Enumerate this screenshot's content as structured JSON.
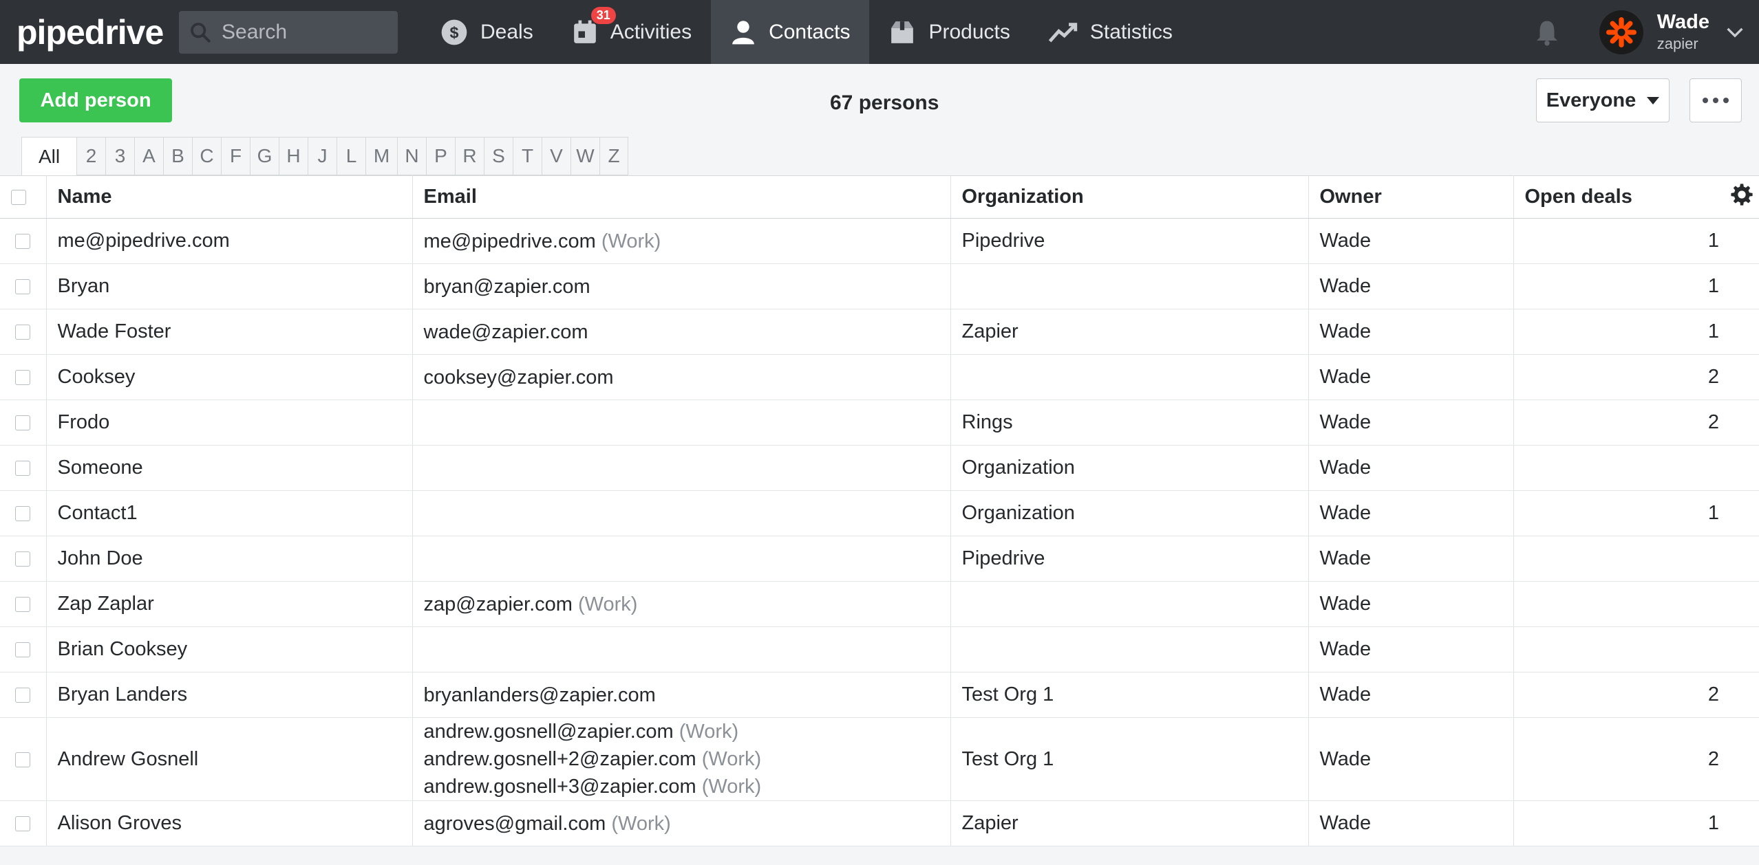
{
  "app": {
    "logo": "pipedrive"
  },
  "search": {
    "placeholder": "Search"
  },
  "nav": [
    {
      "label": "Deals",
      "icon": "dollar-icon"
    },
    {
      "label": "Activities",
      "icon": "calendar-icon",
      "badge": "31"
    },
    {
      "label": "Contacts",
      "icon": "person-icon",
      "active": true
    },
    {
      "label": "Products",
      "icon": "box-icon"
    },
    {
      "label": "Statistics",
      "icon": "trend-icon"
    }
  ],
  "user": {
    "name": "Wade",
    "company": "zapier"
  },
  "toolbar": {
    "add_label": "Add person",
    "count": "67 persons",
    "filter_label": "Everyone"
  },
  "alphabet": [
    "All",
    "2",
    "3",
    "A",
    "B",
    "C",
    "F",
    "G",
    "H",
    "J",
    "L",
    "M",
    "N",
    "P",
    "R",
    "S",
    "T",
    "V",
    "W",
    "Z"
  ],
  "columns": {
    "name": "Name",
    "email": "Email",
    "organization": "Organization",
    "owner": "Owner",
    "open_deals": "Open deals"
  },
  "work_tag": "(Work)",
  "rows": [
    {
      "name": "me@pipedrive.com",
      "emails": [
        {
          "addr": "me@pipedrive.com",
          "tag": "(Work)"
        }
      ],
      "org": "Pipedrive",
      "owner": "Wade",
      "deals": "1"
    },
    {
      "name": "Bryan",
      "emails": [
        {
          "addr": "bryan@zapier.com",
          "tag": ""
        }
      ],
      "org": "",
      "owner": "Wade",
      "deals": "1"
    },
    {
      "name": "Wade Foster",
      "emails": [
        {
          "addr": "wade@zapier.com",
          "tag": ""
        }
      ],
      "org": "Zapier",
      "owner": "Wade",
      "deals": "1"
    },
    {
      "name": "Cooksey",
      "emails": [
        {
          "addr": "cooksey@zapier.com",
          "tag": ""
        }
      ],
      "org": "",
      "owner": "Wade",
      "deals": "2"
    },
    {
      "name": "Frodo",
      "emails": [],
      "org": "Rings",
      "owner": "Wade",
      "deals": "2"
    },
    {
      "name": "Someone",
      "emails": [],
      "org": "Organization",
      "owner": "Wade",
      "deals": ""
    },
    {
      "name": "Contact1",
      "emails": [],
      "org": "Organization",
      "owner": "Wade",
      "deals": "1"
    },
    {
      "name": "John Doe",
      "emails": [],
      "org": "Pipedrive",
      "owner": "Wade",
      "deals": ""
    },
    {
      "name": "Zap Zaplar",
      "emails": [
        {
          "addr": "zap@zapier.com",
          "tag": "(Work)"
        }
      ],
      "org": "",
      "owner": "Wade",
      "deals": ""
    },
    {
      "name": "Brian Cooksey",
      "emails": [],
      "org": "",
      "owner": "Wade",
      "deals": ""
    },
    {
      "name": "Bryan Landers",
      "emails": [
        {
          "addr": "bryanlanders@zapier.com",
          "tag": ""
        }
      ],
      "org": "Test Org 1",
      "owner": "Wade",
      "deals": "2"
    },
    {
      "name": "Andrew Gosnell",
      "emails": [
        {
          "addr": "andrew.gosnell@zapier.com",
          "tag": "(Work)"
        },
        {
          "addr": "andrew.gosnell+2@zapier.com",
          "tag": "(Work)"
        },
        {
          "addr": "andrew.gosnell+3@zapier.com",
          "tag": "(Work)"
        }
      ],
      "org": "Test Org 1",
      "owner": "Wade",
      "deals": "2"
    },
    {
      "name": "Alison Groves",
      "emails": [
        {
          "addr": "agroves@gmail.com",
          "tag": "(Work)"
        }
      ],
      "org": "Zapier",
      "owner": "Wade",
      "deals": "1"
    }
  ]
}
